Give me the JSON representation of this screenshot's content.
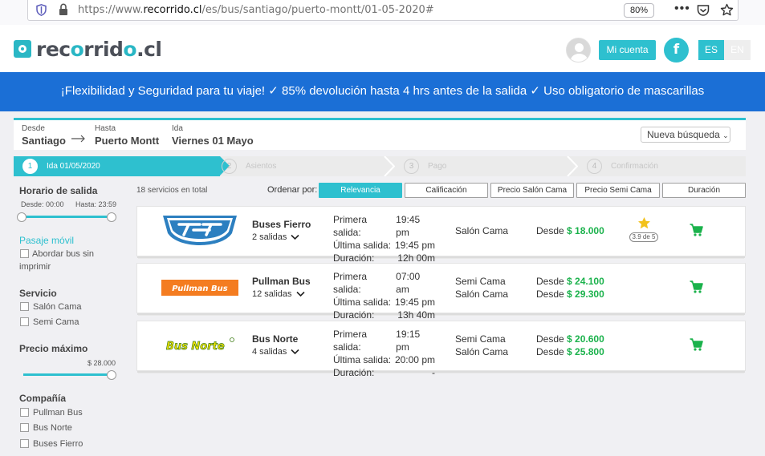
{
  "browser": {
    "url_prefix": "https://www.",
    "url_host": "recorrido.cl",
    "url_path": "/es/bus/santiago/puerto-montt/01-05-2020#",
    "zoom": "80%",
    "menu_dots": "•••"
  },
  "header": {
    "logo_pre": "rec",
    "logo_o": "o",
    "logo_post": "rrid",
    "logo_o2": "o",
    "logo_tld": ".cl",
    "account_label": "Mi cuenta",
    "facebook_label": "f",
    "lang_es": "ES",
    "lang_en": "EN"
  },
  "banner": {
    "text": "¡Flexibilidad y Seguridad para tu viaje! ✓ 85% devolución hasta 4 hrs antes de la salida ✓ Uso obligatorio de mascarillas"
  },
  "summary": {
    "from_label": "Desde",
    "from_value": "Santiago",
    "to_label": "Hasta",
    "to_value": "Puerto Montt",
    "date_label": "Ida",
    "date_value": "Viernes 01 Mayo",
    "new_search": "Nueva búsqueda"
  },
  "steps": [
    {
      "num": "1",
      "label": "Ida 01/05/2020"
    },
    {
      "num": "2",
      "label": "Asientos"
    },
    {
      "num": "3",
      "label": "Pago"
    },
    {
      "num": "4",
      "label": "Confirmación"
    }
  ],
  "filters": {
    "departure_title": "Horario de salida",
    "departure_from": "Desde: 00:00",
    "departure_to": "Hasta: 23:59",
    "pasaje_movil": "Pasaje móvil",
    "board_without_print": "Abordar bus sin imprimir",
    "service_title": "Servicio",
    "services": [
      "Salón Cama",
      "Semi Cama"
    ],
    "max_price_title": "Precio máximo",
    "max_price_value": "$ 28.000",
    "max_price_fraction": 1.0,
    "company_title": "Compañía",
    "companies": [
      "Pullman Bus",
      "Bus Norte",
      "Buses Fierro"
    ]
  },
  "sort": {
    "count": "18 servicios en total",
    "label": "Ordenar por:",
    "options": [
      "Relevancia",
      "Calificación",
      "Precio Salón Cama",
      "Precio Semi Cama",
      "Duración"
    ],
    "active": "Relevancia"
  },
  "results": [
    {
      "company": "Buses Fierro",
      "exits": "2 salidas",
      "first_label": "Primera salida:",
      "first": "19:45 pm",
      "last_label": "Última salida:",
      "last": "19:45 pm",
      "duration_label": "Duración:",
      "duration": "12h 00m",
      "seats": [
        "Salón Cama"
      ],
      "price_prefix": "Desde ",
      "prices": [
        "$ 18.000"
      ],
      "rating": "3.9 de 5"
    },
    {
      "company": "Pullman Bus",
      "logo_text": "Pullman Bus",
      "exits": "12 salidas",
      "first_label": "Primera salida:",
      "first": "07:00 am",
      "last_label": "Última salida:",
      "last": "19:45 pm",
      "duration_label": "Duración:",
      "duration": "13h 40m",
      "seats": [
        "Semi Cama",
        "Salón Cama"
      ],
      "price_prefix": "Desde ",
      "prices": [
        "$ 24.100",
        "$ 29.300"
      ]
    },
    {
      "company": "Bus Norte",
      "logo_text": "Bus Norte",
      "exits": "4 salidas",
      "first_label": "Primera salida:",
      "first": "19:15 pm",
      "last_label": "Última salida:",
      "last": "20:00 pm",
      "duration_label": "Duración:",
      "duration": "-",
      "seats": [
        "Semi Cama",
        "Salón Cama"
      ],
      "price_prefix": "Desde ",
      "prices": [
        "$ 20.600",
        "$ 25.800"
      ]
    }
  ],
  "colors": {
    "accent": "#2ec0cf",
    "banner": "#1b6fd6",
    "price": "#1bb24c",
    "pullman_orange": "#f47c20",
    "bus_norte_yellow": "#f5e400",
    "fierro_blue": "#2c7fc0"
  },
  "icons": [
    "shield-icon",
    "lock-icon",
    "pocket-icon",
    "star-icon",
    "avatar-icon",
    "facebook-icon",
    "cart-icon",
    "chevron-down-icon",
    "arrow-right-icon"
  ]
}
